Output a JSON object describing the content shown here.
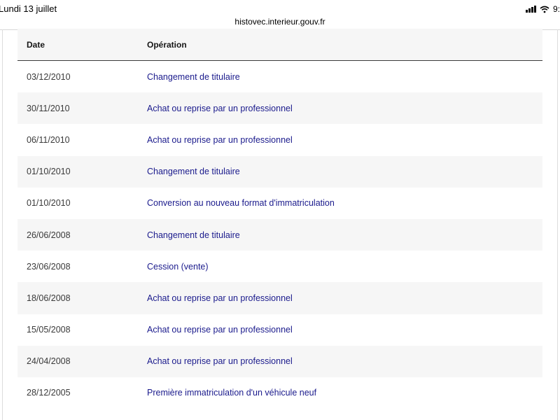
{
  "status": {
    "time": "Lundi 13 juillet",
    "battery_partial": "9:"
  },
  "browser": {
    "url": "histovec.interieur.gouv.fr"
  },
  "table": {
    "headers": {
      "date": "Date",
      "operation": "Opération"
    },
    "rows": [
      {
        "date": "03/12/2010",
        "operation": "Changement de titulaire"
      },
      {
        "date": "30/11/2010",
        "operation": "Achat ou reprise par un professionnel"
      },
      {
        "date": "06/11/2010",
        "operation": "Achat ou reprise par un professionnel"
      },
      {
        "date": "01/10/2010",
        "operation": "Changement de titulaire"
      },
      {
        "date": "01/10/2010",
        "operation": "Conversion au nouveau format d'immatriculation"
      },
      {
        "date": "26/06/2008",
        "operation": "Changement de titulaire"
      },
      {
        "date": "23/06/2008",
        "operation": "Cession (vente)"
      },
      {
        "date": "18/06/2008",
        "operation": "Achat ou reprise par un professionnel"
      },
      {
        "date": "15/05/2008",
        "operation": "Achat ou reprise par un professionnel"
      },
      {
        "date": "24/04/2008",
        "operation": "Achat ou reprise par un professionnel"
      },
      {
        "date": "28/12/2005",
        "operation": "Première immatriculation d'un véhicule neuf"
      }
    ]
  },
  "colors": {
    "link": "#1a1a8c",
    "row_alt": "#f6f6f6",
    "header_border": "#3a3a3a"
  }
}
